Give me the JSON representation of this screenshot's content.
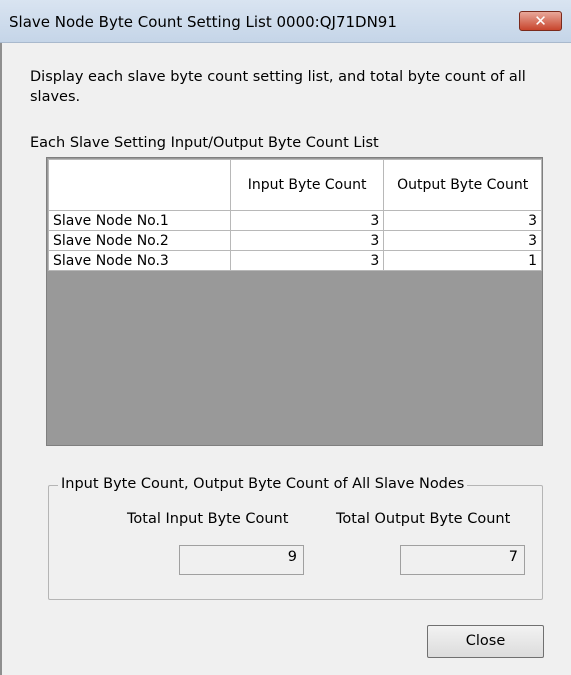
{
  "window": {
    "title": "Slave Node Byte Count Setting List 0000:QJ71DN91",
    "close_icon": "✕"
  },
  "description": "Display each slave byte count setting list, and total byte count of all slaves.",
  "list": {
    "label": "Each Slave Setting Input/Output Byte Count List",
    "columns": [
      "",
      "Input Byte Count",
      "Output Byte Count"
    ],
    "rows": [
      {
        "name": "Slave Node No.1",
        "input": "3",
        "output": "3"
      },
      {
        "name": "Slave Node No.2",
        "input": "3",
        "output": "3"
      },
      {
        "name": "Slave Node No.3",
        "input": "3",
        "output": "1"
      }
    ]
  },
  "totals": {
    "group_title": "Input Byte Count, Output Byte Count of All Slave Nodes",
    "input_label": "Total Input Byte Count",
    "output_label": "Total Output Byte Count",
    "input_value": "9",
    "output_value": "7"
  },
  "buttons": {
    "close": "Close"
  }
}
